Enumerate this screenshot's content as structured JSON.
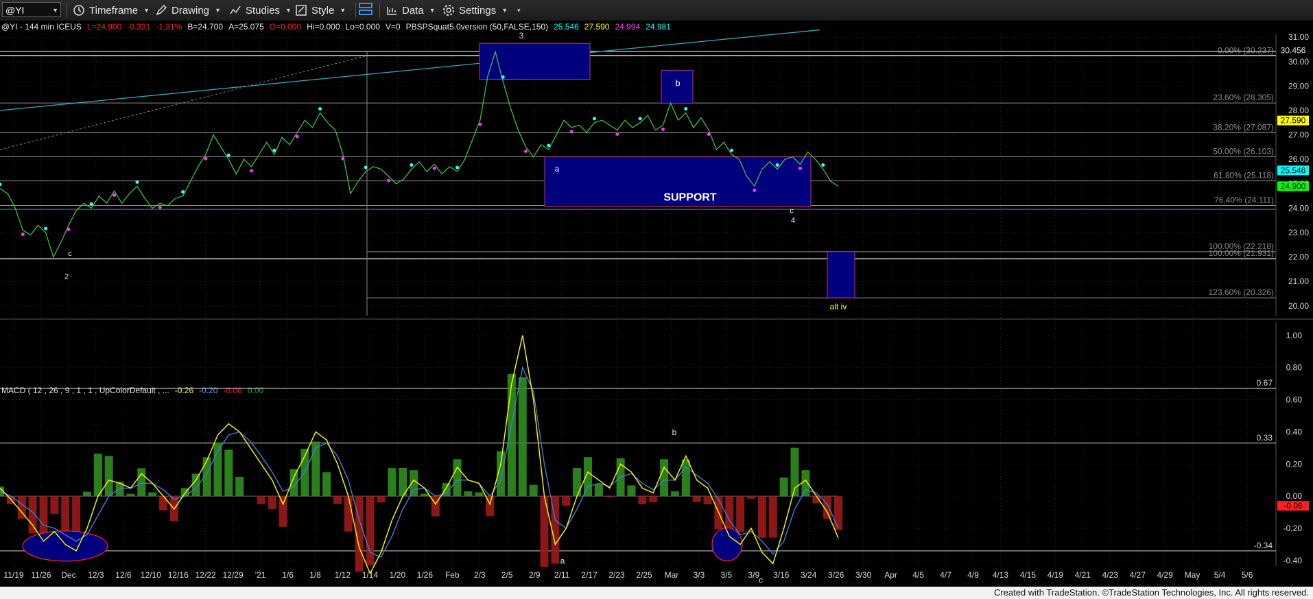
{
  "toolbar": {
    "symbol": "@YI",
    "timeframe_label": "Timeframe",
    "drawing_label": "Drawing",
    "studies_label": "Studies",
    "style_label": "Style",
    "data_label": "Data",
    "settings_label": "Settings"
  },
  "header": {
    "title": "@YI - 144 min  ICEUS",
    "last": "L=24.900",
    "chg": "-0.331",
    "pct": "-1.31%",
    "bid": "B=24.700",
    "ask": "A=25.075",
    "open": "O=0.000",
    "hi": "Hi=0.000",
    "lo": "Lo=0.000",
    "vol": "V=0",
    "study": "PBSPSquat5.0version (50,FALSE,150)",
    "study_values": [
      "25.546",
      "27.590",
      "24.994",
      "24.981"
    ]
  },
  "colors": {
    "background": "#000000",
    "price": "#3fbf3f",
    "blue_box": "#00007f",
    "box_border": "#c83278",
    "fib": "#8a8a8a",
    "macd": "#f2f200",
    "signal": "#3e7fd6",
    "hist_up": "#2f8f1f",
    "hist_down": "#9a1a1a",
    "label_yellow": "#ffff00",
    "label_green": "#00ff00",
    "label_cyan": "#00ffff",
    "label_red": "#ff2020"
  },
  "chart_data": [
    {
      "type": "line",
      "title": "@YI - 144 min ICEUS",
      "ylim": [
        19.6,
        31.4
      ],
      "y_ticks": [
        "31.00",
        "30.00",
        "29.00",
        "28.00",
        "27.00",
        "26.00",
        "25.00",
        "24.00",
        "23.00",
        "22.00",
        "21.00",
        "20.00"
      ],
      "series": [
        {
          "values": [
            24.8,
            24.6,
            24.0,
            23.1,
            22.9,
            23.3,
            23.0,
            22.0,
            22.6,
            23.3,
            23.9,
            24.2,
            24.0,
            24.5,
            24.2,
            24.7,
            24.2,
            24.6,
            24.9,
            24.4,
            24.0,
            24.2,
            24.1,
            24.4,
            24.5,
            25.1,
            25.7,
            26.2,
            27.0,
            26.5,
            26.0,
            25.4,
            26.0,
            25.7,
            26.2,
            26.7,
            26.2,
            26.9,
            26.6,
            27.1,
            27.6,
            27.3,
            27.9,
            27.5,
            27.2,
            26.2,
            24.6,
            25.1,
            25.5,
            25.7,
            25.6,
            25.3,
            25.0,
            25.2,
            25.6,
            25.9,
            25.5,
            25.8,
            25.4,
            25.7,
            25.5,
            26.0,
            26.8,
            27.6,
            29.4,
            30.4,
            29.2,
            28.1,
            27.2,
            26.5,
            26.1,
            26.6,
            26.4,
            27.0,
            27.6,
            27.3,
            27.4,
            27.1,
            27.5,
            27.6,
            27.4,
            27.2,
            27.6,
            27.3,
            27.5,
            27.8,
            27.2,
            27.4,
            28.3,
            27.6,
            27.9,
            27.3,
            27.7,
            27.2,
            26.4,
            26.7,
            26.2,
            26.0,
            25.3,
            24.9,
            25.6,
            25.9,
            25.6,
            26.0,
            26.1,
            25.8,
            26.3,
            26.0,
            25.6,
            25.1,
            24.9
          ]
        }
      ],
      "fib_levels": [
        {
          "pct": "0.00%",
          "price": "30.237"
        },
        {
          "pct": "23.60%",
          "price": "28.305"
        },
        {
          "pct": "38.20%",
          "price": "27.087"
        },
        {
          "pct": "50.00%",
          "price": "26.103"
        },
        {
          "pct": "61.80%",
          "price": "25.118"
        },
        {
          "pct": "76.40%",
          "price": "24.111"
        },
        {
          "pct": "100.00%",
          "price": "22.218"
        },
        {
          "pct": "100.00%",
          "price": "21.931"
        },
        {
          "pct": "123.60%",
          "price": "20.326"
        }
      ],
      "right_labels": [
        "30.456",
        "27.590",
        "25.546",
        "24.900"
      ],
      "annotations": [
        "3",
        "b",
        "a",
        "SUPPORT",
        "c",
        "4",
        "c",
        "2",
        "alt iv"
      ]
    },
    {
      "type": "line",
      "title": "MACD ( 12 , 26 , 9 , 1 , 1 , UpColorDefault , ...",
      "values_text": [
        "-0.26",
        "-0.20",
        "-0.06",
        "0.00"
      ],
      "ylim": [
        -0.52,
        1.08
      ],
      "y_ticks": [
        "1.00",
        "0.80",
        "0.60",
        "0.40",
        "0.20",
        "0.00",
        "-0.20",
        "-0.40"
      ],
      "levels": [
        "0.67",
        "0.33",
        "-0.34"
      ],
      "right_labels": [
        "-0.06"
      ],
      "annotations": [
        "b",
        "a",
        "c"
      ],
      "series": [
        {
          "name": "MACD",
          "values": [
            0.05,
            -0.02,
            -0.1,
            -0.18,
            -0.28,
            -0.22,
            -0.3,
            -0.34,
            -0.2,
            0.0,
            0.1,
            0.08,
            0.05,
            0.14,
            0.08,
            0.0,
            -0.08,
            0.02,
            0.1,
            0.22,
            0.38,
            0.45,
            0.4,
            0.3,
            0.2,
            0.1,
            -0.05,
            0.12,
            0.25,
            0.4,
            0.35,
            0.2,
            0.0,
            -0.32,
            -0.48,
            -0.35,
            -0.15,
            0.0,
            0.1,
            0.05,
            -0.05,
            0.05,
            0.18,
            0.1,
            0.08,
            -0.05,
            0.2,
            0.7,
            1.0,
            0.6,
            0.0,
            -0.3,
            -0.2,
            0.0,
            0.15,
            0.1,
            0.05,
            0.2,
            0.15,
            0.05,
            0.02,
            0.18,
            0.1,
            0.25,
            0.1,
            0.05,
            -0.1,
            -0.25,
            -0.3,
            -0.2,
            -0.35,
            -0.42,
            -0.2,
            0.05,
            0.1,
            0.0,
            -0.1,
            -0.26
          ]
        },
        {
          "name": "Signal",
          "values": [
            0.03,
            0.0,
            -0.05,
            -0.1,
            -0.18,
            -0.2,
            -0.24,
            -0.28,
            -0.24,
            -0.12,
            0.0,
            0.05,
            0.05,
            0.08,
            0.08,
            0.04,
            -0.02,
            0.0,
            0.05,
            0.14,
            0.28,
            0.38,
            0.4,
            0.34,
            0.25,
            0.15,
            0.03,
            0.06,
            0.15,
            0.3,
            0.33,
            0.25,
            0.1,
            -0.15,
            -0.35,
            -0.38,
            -0.25,
            -0.08,
            0.04,
            0.05,
            0.0,
            0.02,
            0.1,
            0.1,
            0.08,
            0.0,
            0.1,
            0.45,
            0.8,
            0.65,
            0.2,
            -0.15,
            -0.2,
            -0.08,
            0.06,
            0.08,
            0.06,
            0.12,
            0.14,
            0.08,
            0.04,
            0.1,
            0.1,
            0.18,
            0.13,
            0.08,
            -0.02,
            -0.15,
            -0.24,
            -0.22,
            -0.28,
            -0.36,
            -0.28,
            -0.08,
            0.04,
            0.02,
            -0.05,
            -0.2
          ]
        }
      ]
    }
  ],
  "x_axis_labels": [
    "11/19",
    "11/26",
    "Dec",
    "12/3",
    "12/6",
    "12/10",
    "12/16",
    "12/22",
    "12/29",
    "'21",
    "1/6",
    "1/8",
    "1/12",
    "1/14",
    "1/20",
    "1/26",
    "Feb",
    "2/3",
    "2/5",
    "2/9",
    "2/11",
    "2/17",
    "2/23",
    "2/25",
    "Mar",
    "3/3",
    "3/5",
    "3/9",
    "3/16",
    "3/24",
    "3/26",
    "3/30",
    "Apr",
    "4/5",
    "4/7",
    "4/9",
    "4/13",
    "4/15",
    "4/19",
    "4/21",
    "4/23",
    "4/27",
    "4/29",
    "May",
    "5/4",
    "5/6"
  ],
  "footer": "Created with TradeStation. ©TradeStation Technologies, Inc. All rights reserved."
}
